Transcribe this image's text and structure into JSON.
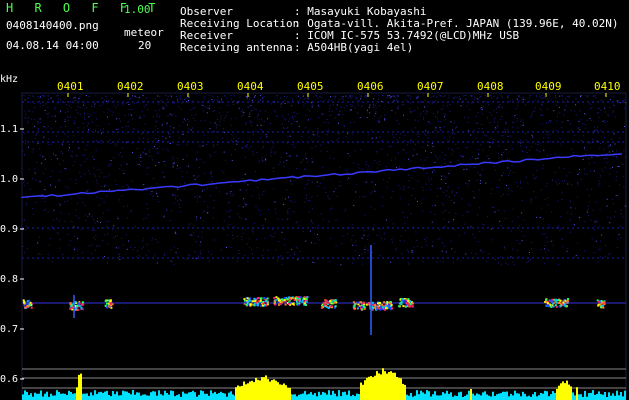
{
  "header": {
    "app_name": "H R O F F T",
    "version": "1.00",
    "filename": "0408140400.png",
    "meteor_label": "meteor",
    "datetime": "04.08.14 04:00",
    "meteor_count": "20",
    "observer_label": "Observer",
    "observer_value": ": Masayuki Kobayashi",
    "location_label": "Receiving Location",
    "location_value": ": Ogata-vill. Akita-Pref. JAPAN (139.96E, 40.02N)",
    "receiver_label": "Receiver",
    "receiver_value": ": ICOM IC-575 53.7492(@LCD)MHz USB",
    "antenna_label": "Receiving antenna",
    "antenna_value": ": A504HB(yagi 4el)"
  },
  "time_ticks": [
    "0401",
    "0402",
    "0403",
    "0404",
    "0405",
    "0406",
    "0407",
    "0408",
    "0409",
    "0410"
  ],
  "freq_axis": {
    "unit": "kHz",
    "labels": [
      "1.1",
      "1.0",
      "0.9",
      "0.8",
      "0.7",
      "0.6"
    ]
  },
  "colors": {
    "background": "#000000",
    "title_green": "#4cff4c",
    "tick_yellow": "#ffff00",
    "noise_blue": "#2a2aff",
    "level_yellow": "#ffff00",
    "level_cyan": "#00e0ff",
    "echo_red": "#ff2060"
  }
}
